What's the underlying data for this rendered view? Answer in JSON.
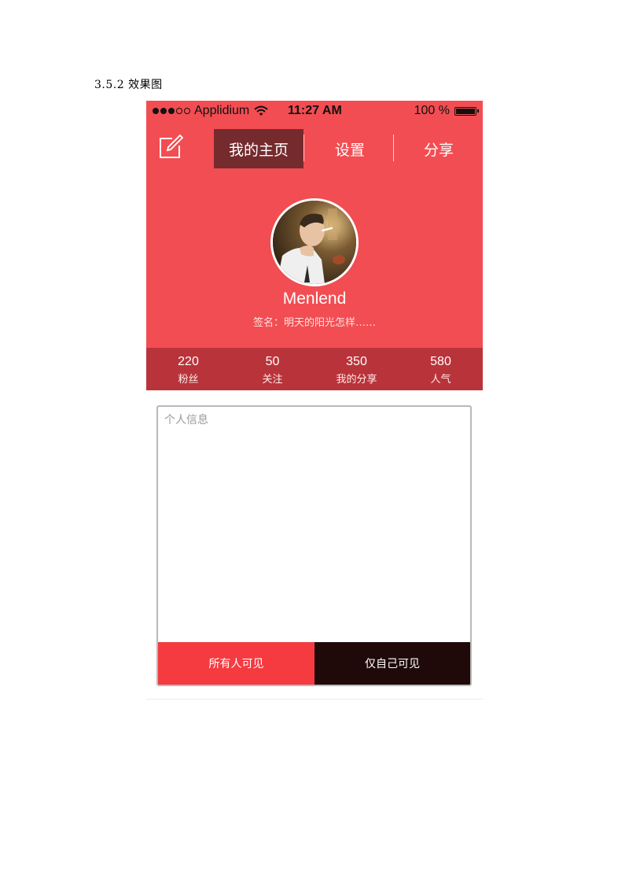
{
  "document": {
    "heading": "3.5.2 效果图"
  },
  "status_bar": {
    "carrier": "Applidium",
    "signal_bars": [
      true,
      true,
      true,
      false,
      false
    ],
    "time": "11:27 AM",
    "battery": "100 %",
    "battery_level": 1.0
  },
  "nav": {
    "tabs": [
      {
        "label": "我的主页",
        "active": true
      },
      {
        "label": "设置",
        "active": false
      },
      {
        "label": "分享",
        "active": false
      }
    ]
  },
  "profile": {
    "username": "Menlend",
    "signature": "签名：明天的阳光怎样……"
  },
  "stats": [
    {
      "value": "220",
      "label": "粉丝"
    },
    {
      "value": "50",
      "label": "关注"
    },
    {
      "value": "350",
      "label": "我的分享"
    },
    {
      "value": "580",
      "label": "人气"
    }
  ],
  "info": {
    "placeholder": "个人信息",
    "value": "",
    "public_label": "所有人可见",
    "private_label": "仅自己可见"
  },
  "colors": {
    "header_red": "#f24d52",
    "active_tab": "#752b2e",
    "stats_bar": "#b9343a",
    "public_button": "#f53b40",
    "private_button": "#1f0a09"
  }
}
